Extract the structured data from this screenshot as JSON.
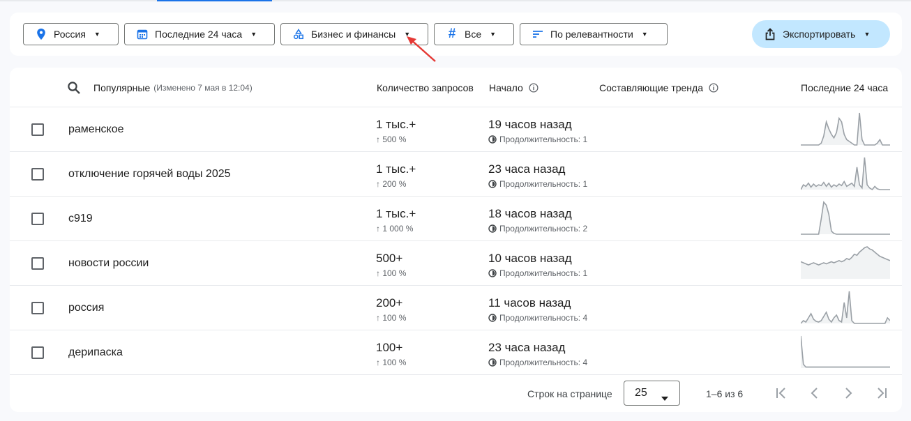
{
  "filters": {
    "region": "Россия",
    "period": "Последние 24 часа",
    "category": "Бизнес и финансы",
    "trend_type": "Все",
    "sort": "По релевантности"
  },
  "export_label": "Экспортировать",
  "table": {
    "header": {
      "title": "Популярные",
      "updated": "(Изменено 7 мая в 12:04)",
      "volume": "Количество запросов",
      "started": "Начало",
      "breakdown": "Составляющие тренда",
      "last24": "Последние 24 часа"
    },
    "rows": [
      {
        "term": "раменское",
        "volume": "1 тыс.+",
        "change": "↑ 500 %",
        "started": "19 часов назад",
        "duration": "Продолжительность: 1",
        "spark": [
          0,
          0,
          0,
          0,
          0,
          0,
          0,
          0,
          2,
          10,
          26,
          18,
          12,
          8,
          14,
          30,
          26,
          12,
          6,
          4,
          2,
          0,
          0,
          36,
          6,
          0,
          0,
          0,
          0,
          0,
          2,
          6,
          0,
          0,
          0,
          0
        ]
      },
      {
        "term": "отключение горячей воды 2025",
        "volume": "1 тыс.+",
        "change": "↑ 200 %",
        "started": "23 часа назад",
        "duration": "Продолжительность: 1",
        "spark": [
          0,
          6,
          4,
          8,
          3,
          7,
          4,
          6,
          5,
          9,
          4,
          8,
          3,
          6,
          4,
          7,
          5,
          10,
          4,
          6,
          8,
          4,
          28,
          6,
          2,
          40,
          6,
          2,
          0,
          4,
          1,
          0,
          0,
          0,
          0,
          0
        ]
      },
      {
        "term": "с919",
        "volume": "1 тыс.+",
        "change": "↑ 1 000 %",
        "started": "18 часов назад",
        "duration": "Продолжительность: 2",
        "spark": [
          0,
          0,
          0,
          0,
          0,
          0,
          0,
          0,
          20,
          42,
          38,
          26,
          4,
          1,
          0,
          0,
          0,
          0,
          0,
          0,
          0,
          0,
          0,
          0,
          0,
          0,
          0,
          0,
          0,
          0,
          0,
          0,
          0,
          0,
          0,
          0
        ]
      },
      {
        "term": "новости россии",
        "volume": "500+",
        "change": "↑ 100 %",
        "started": "10 часов назад",
        "duration": "Продолжительность: 1",
        "spark": [
          16,
          15,
          14,
          13,
          14,
          15,
          14,
          13,
          14,
          15,
          14,
          15,
          16,
          15,
          16,
          17,
          16,
          17,
          19,
          18,
          20,
          23,
          22,
          25,
          27,
          29,
          30,
          28,
          27,
          25,
          23,
          21,
          20,
          19,
          18,
          17
        ]
      },
      {
        "term": "россия",
        "volume": "200+",
        "change": "↑ 100 %",
        "started": "11 часов назад",
        "duration": "Продолжительность: 4",
        "spark": [
          0,
          4,
          2,
          8,
          14,
          6,
          3,
          2,
          4,
          10,
          16,
          6,
          2,
          8,
          12,
          4,
          2,
          30,
          8,
          46,
          4,
          0,
          0,
          0,
          0,
          0,
          0,
          0,
          0,
          0,
          0,
          0,
          0,
          0,
          8,
          4
        ]
      },
      {
        "term": "дерипаска",
        "volume": "100+",
        "change": "↑ 100 %",
        "started": "23 часа назад",
        "duration": "Продолжительность: 4",
        "spark": [
          34,
          4,
          1,
          1,
          1,
          1,
          1,
          1,
          1,
          1,
          1,
          1,
          1,
          1,
          1,
          1,
          1,
          1,
          1,
          1,
          1,
          1,
          1,
          1,
          1,
          1,
          1,
          1,
          1,
          1,
          1,
          1,
          1,
          1,
          1,
          1
        ]
      }
    ]
  },
  "pagination": {
    "rows_per_page_label": "Строк на странице",
    "rows_per_page": "25",
    "range": "1–6 из 6"
  },
  "colors": {
    "accent": "#1a73e8",
    "export_bg": "#c2e7ff",
    "spark": "#9aa0a6",
    "arrow": "#e53935"
  }
}
